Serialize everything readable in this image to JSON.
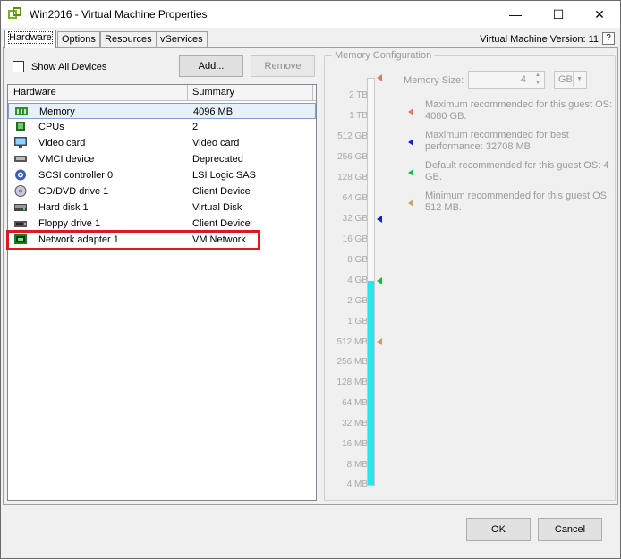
{
  "window": {
    "title": "Win2016 - Virtual Machine Properties",
    "minimize": "—",
    "maximize": "☐",
    "close": "✕"
  },
  "tabs": [
    {
      "label": "Hardware"
    },
    {
      "label": "Options"
    },
    {
      "label": "Resources"
    },
    {
      "label": "vServices"
    }
  ],
  "vm_version": "Virtual Machine Version: 11",
  "help": "?",
  "hardware_panel": {
    "show_all_label": "Show All Devices",
    "add_label": "Add...",
    "remove_label": "Remove",
    "col_hardware": "Hardware",
    "col_summary": "Summary",
    "rows": [
      {
        "name": "Memory",
        "summary": "4096 MB",
        "icon": "memory-icon"
      },
      {
        "name": "CPUs",
        "summary": "2",
        "icon": "cpu-icon"
      },
      {
        "name": "Video card",
        "summary": "Video card",
        "icon": "monitor-icon"
      },
      {
        "name": "VMCI device",
        "summary": "Deprecated",
        "icon": "vmci-icon"
      },
      {
        "name": "SCSI controller 0",
        "summary": "LSI Logic SAS",
        "icon": "scsi-icon"
      },
      {
        "name": "CD/DVD drive 1",
        "summary": "Client Device",
        "icon": "cd-icon"
      },
      {
        "name": "Hard disk 1",
        "summary": "Virtual Disk",
        "icon": "harddisk-icon"
      },
      {
        "name": "Floppy drive 1",
        "summary": "Client Device",
        "icon": "floppy-icon"
      },
      {
        "name": "Network adapter 1",
        "summary": "VM Network",
        "icon": "network-adapter-icon"
      }
    ]
  },
  "memory": {
    "group_title": "Memory Configuration",
    "size_label": "Memory Size:",
    "size_value": "4",
    "unit": "GB",
    "scale": [
      "2 TB",
      "1 TB",
      "512 GB",
      "256 GB",
      "128 GB",
      "64 GB",
      "32 GB",
      "16 GB",
      "8 GB",
      "4 GB",
      "2 GB",
      "1 GB",
      "512 MB",
      "256 MB",
      "128 MB",
      "64 MB",
      "32 MB",
      "16 MB",
      "8 MB",
      "4 MB"
    ],
    "recommendations": [
      {
        "text": "Maximum recommended for this guest OS: 4080 GB.",
        "color": "#e8756a"
      },
      {
        "text": "Maximum recommended for best performance: 32708 MB.",
        "color": "#1b1bd6"
      },
      {
        "text": "Default recommended for this guest OS: 4 GB.",
        "color": "#1fb83f"
      },
      {
        "text": "Minimum recommended for this guest OS: 512 MB.",
        "color": "#c8a165"
      }
    ],
    "fill_color": "#23e9ef"
  },
  "footer": {
    "ok_label": "OK",
    "cancel_label": "Cancel"
  }
}
